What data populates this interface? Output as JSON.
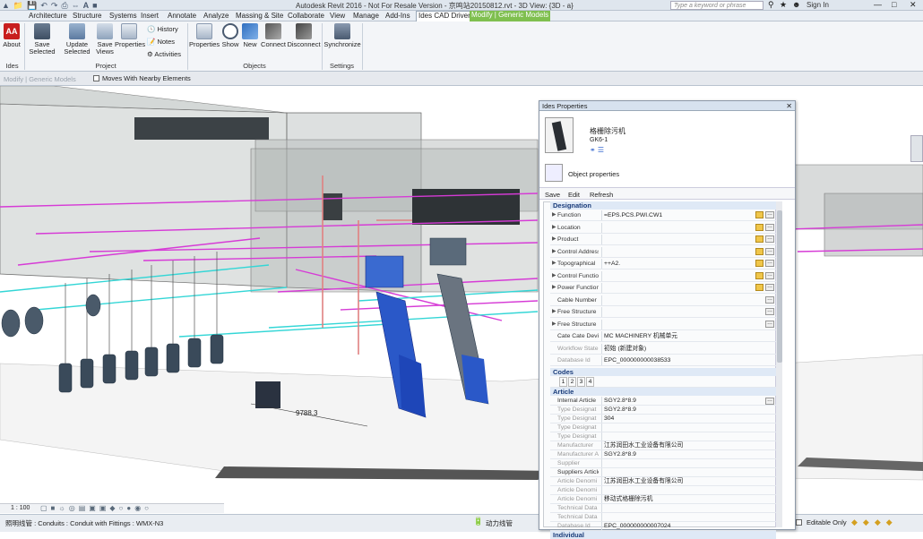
{
  "titlebar": {
    "title": "Autodesk Revit 2016 - Not For Resale Version -     京鸣站20150812.rvt - 3D View: {3D - a}",
    "search_placeholder": "Type a keyword or phrase",
    "sign_in": "Sign In"
  },
  "menu": [
    "Architecture",
    "Structure",
    "Systems",
    "Insert",
    "Annotate",
    "Analyze",
    "Massing & Site",
    "Collaborate",
    "View",
    "Manage",
    "Add-Ins",
    "Ides CAD Driver",
    "Modify | Generic Models"
  ],
  "ribbon": {
    "about": "About",
    "save_selected": "Save Selected",
    "update_selected": "Update Selected",
    "save_views": "Save Views",
    "properties": "Properties",
    "history": "History",
    "notes": "Notes",
    "activities": "Activities",
    "properties2": "Properties",
    "show": "Show",
    "new": "New",
    "connect": "Connect",
    "disconnect": "Disconnect",
    "synchronize": "Synchronize",
    "panel_ides": "Ides",
    "panel_project": "Project",
    "panel_objects": "Objects",
    "panel_settings": "Settings"
  },
  "optionsbar": {
    "context": "Modify | Generic Models",
    "moves_with": "Moves With Nearby Elements"
  },
  "viewport": {
    "dimension": "9788.3"
  },
  "viewctl": {
    "scale": "1 : 100"
  },
  "statusbar": {
    "left": "照明线管 : Conduits : Conduit with Fittings : WMX-N3",
    "mid": "动力线管",
    "editable": "Editable Only"
  },
  "props": {
    "title": "Ides Properties",
    "obj_name": "格栅除污机",
    "obj_code": "GK6-1",
    "obj_props": "Object properties",
    "save": "Save",
    "edit": "Edit",
    "refresh": "Refresh",
    "cat_designation": "Designation",
    "cat_codes": "Codes",
    "cat_article": "Article",
    "cat_individual": "Individual",
    "designation_rows": [
      {
        "k": "Function",
        "v": "=EPS.PCS.PWI.CW1",
        "tri": true,
        "gray": false
      },
      {
        "k": "Location",
        "v": "",
        "tri": true,
        "gray": false
      },
      {
        "k": "Product",
        "v": "",
        "tri": true,
        "gray": false
      },
      {
        "k": "Control Address",
        "v": "",
        "tri": true,
        "gray": false
      },
      {
        "k": "Topographical",
        "v": "++A2.",
        "tri": true,
        "gray": false
      },
      {
        "k": "Control Function",
        "v": "",
        "tri": true,
        "gray": false
      },
      {
        "k": "Power Function",
        "v": "",
        "tri": true,
        "gray": false
      },
      {
        "k": "Cable Number",
        "v": "",
        "tri": false,
        "gray": false
      },
      {
        "k": "Free Structure",
        "v": "",
        "tri": true,
        "gray": false
      },
      {
        "k": "Free Structure",
        "v": "",
        "tri": true,
        "gray": false
      },
      {
        "k": "Cate Cate Devi",
        "v": "MC               MACHINERY      机械单元",
        "tri": false,
        "gray": false
      },
      {
        "k": "Workflow State",
        "v": "初始 (新建对象)",
        "tri": false,
        "gray": true
      },
      {
        "k": "Database Id",
        "v": "EPC_000000000038533",
        "tri": false,
        "gray": true
      }
    ],
    "codes_tabs": [
      "1",
      "2",
      "3",
      "4"
    ],
    "article_rows": [
      {
        "k": "Internal Article",
        "v": "SGY2.8*8.9",
        "gray": false
      },
      {
        "k": "Type Designat",
        "v": "SGY2.8*8.9",
        "gray": true
      },
      {
        "k": "Type Designat",
        "v": "304",
        "gray": true
      },
      {
        "k": "Type Designat",
        "v": "",
        "gray": true
      },
      {
        "k": "Type Designat",
        "v": "",
        "gray": true
      },
      {
        "k": "Manufacturer",
        "v": "江苏润田水工业设备有限公司",
        "gray": true
      },
      {
        "k": "Manufacturer A",
        "v": "SGY2.8*8.9",
        "gray": true
      },
      {
        "k": "Supplier",
        "v": "",
        "gray": true
      },
      {
        "k": "Suppliers Article",
        "v": "",
        "gray": false
      },
      {
        "k": "Article Denomi",
        "v": "江苏润田水工业设备有限公司",
        "gray": true
      },
      {
        "k": "Article Denomi",
        "v": "",
        "gray": true
      },
      {
        "k": "Article Denomi",
        "v": "移动式格栅除污机",
        "gray": true
      },
      {
        "k": "Technical Data",
        "v": "",
        "gray": true
      },
      {
        "k": "Technical Data",
        "v": "",
        "gray": true
      },
      {
        "k": "Database Id",
        "v": "EPC_000000000007024",
        "gray": true
      }
    ]
  }
}
